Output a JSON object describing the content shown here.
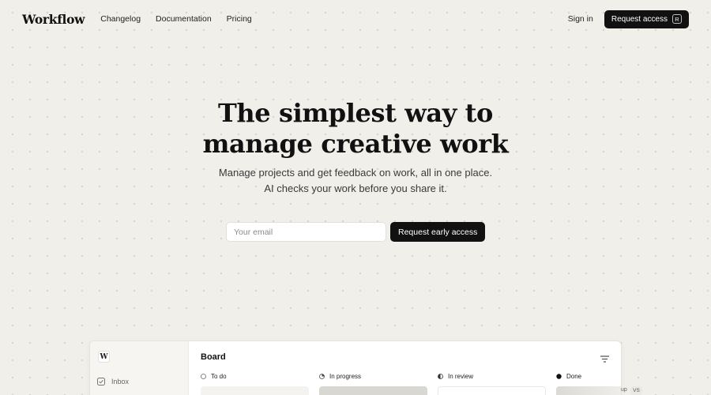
{
  "brand": {
    "logo": "Workflow"
  },
  "nav": {
    "links": [
      "Changelog",
      "Documentation",
      "Pricing"
    ],
    "sign_in": "Sign in",
    "request_access": "Request access",
    "request_access_kbd": "R"
  },
  "hero": {
    "title_line1": "The simplest way to",
    "title_line2": "manage creative work",
    "sub_line1": "Manage projects and get feedback on work, all in one place.",
    "sub_line2": "AI checks your work before you share it.",
    "email_placeholder": "Your email",
    "cta": "Request early access"
  },
  "preview": {
    "logo_letter": "W",
    "sidebar": {
      "inbox": "Inbox"
    },
    "board_title": "Board",
    "columns": [
      {
        "label": "To do",
        "status_icon": "empty-circle"
      },
      {
        "label": "In progress",
        "status_icon": "quarter-circle"
      },
      {
        "label": "In review",
        "status_icon": "half-circle"
      },
      {
        "label": "Done",
        "status_icon": "filled-circle"
      }
    ],
    "edge_text": "up",
    "edge_tag": "VS"
  }
}
